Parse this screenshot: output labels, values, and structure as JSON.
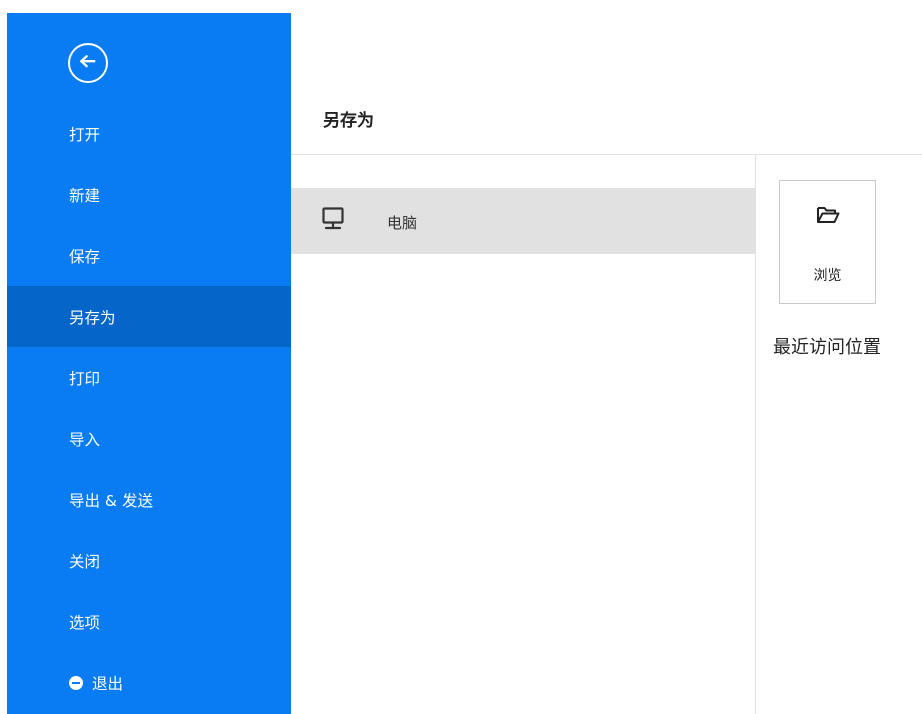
{
  "sidebar": {
    "back_icon": "back-arrow-circle-icon",
    "items": [
      {
        "label": "打开"
      },
      {
        "label": "新建"
      },
      {
        "label": "保存"
      },
      {
        "label": "另存为",
        "active": true
      },
      {
        "label": "打印"
      },
      {
        "label": "导入"
      },
      {
        "label": "导出 & 发送"
      },
      {
        "label": "关闭"
      },
      {
        "label": "选项"
      },
      {
        "label": "退出",
        "icon": "minus-circle-icon"
      }
    ],
    "colors": {
      "background": "#0a7cf3",
      "active": "#0565c8",
      "text": "#ffffff"
    }
  },
  "main": {
    "title": "另存为",
    "locations": [
      {
        "label": "电脑",
        "icon": "computer-icon",
        "selected": true
      }
    ],
    "browse": {
      "label": "浏览",
      "icon": "folder-open-icon"
    },
    "recent_title": "最近访问位置"
  }
}
